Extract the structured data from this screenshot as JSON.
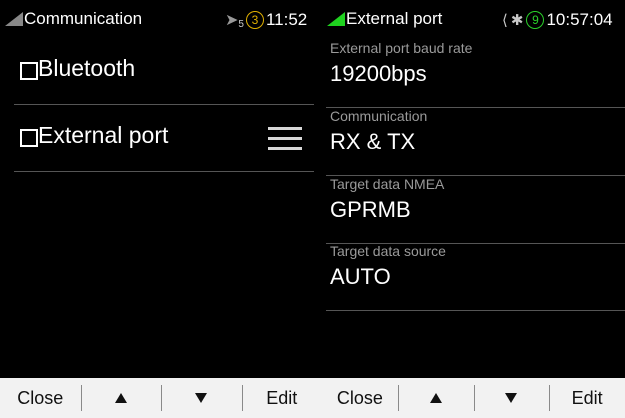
{
  "left": {
    "statusbar": {
      "title": "Communication",
      "icon": "navigation-arrow-icon",
      "sub_number": "5",
      "satellites": "3",
      "time": "11:52"
    },
    "items": [
      {
        "label": "Bluetooth"
      },
      {
        "label": "External port"
      }
    ],
    "toolbar": {
      "close": "Close",
      "edit": "Edit"
    }
  },
  "right": {
    "statusbar": {
      "title": "External port",
      "satellites": "9",
      "time": "10:57:04"
    },
    "properties": [
      {
        "label": "External port baud rate",
        "value": "19200bps"
      },
      {
        "label": "Communication",
        "value": "RX & TX"
      },
      {
        "label": "Target data NMEA",
        "value": "GPRMB"
      },
      {
        "label": "Target data source",
        "value": "AUTO"
      }
    ],
    "toolbar": {
      "close": "Close",
      "edit": "Edit"
    }
  },
  "colors": {
    "accent_green": "#1fd21f",
    "satellite_yellow": "#e0b000",
    "toolbar_bg": "#f2f2f2"
  }
}
